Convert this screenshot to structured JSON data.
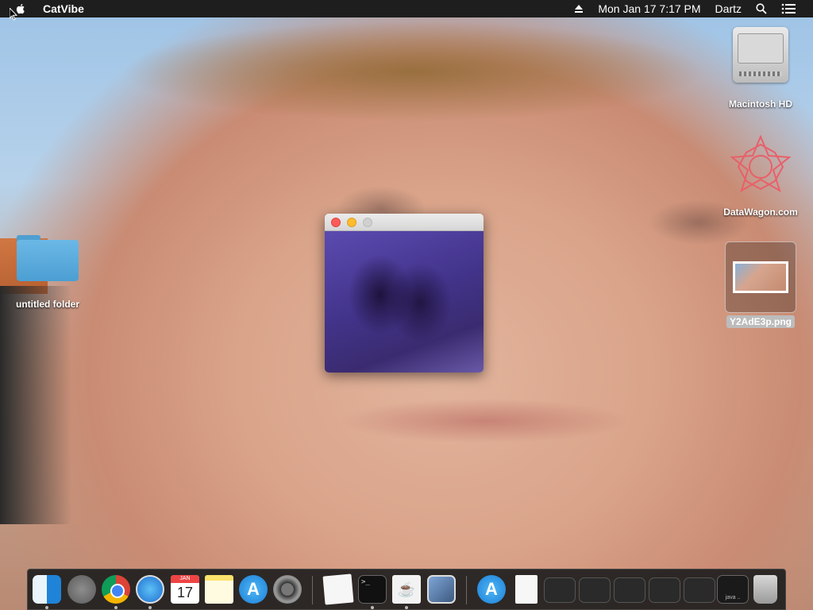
{
  "menubar": {
    "app_name": "CatVibe",
    "datetime": "Mon Jan 17  7:17 PM",
    "user": "Dartz",
    "icons": [
      "apple-icon",
      "eject-icon",
      "search-icon",
      "list-icon"
    ]
  },
  "desktop": {
    "icons": [
      {
        "label": "Macintosh HD",
        "icon": "hard-drive-icon"
      },
      {
        "label": "DataWagon.com",
        "icon": "datawagon-icon"
      },
      {
        "label": "Y2AdE3p.png",
        "icon": "image-file-icon"
      },
      {
        "label": "untitled folder",
        "icon": "folder-icon"
      }
    ]
  },
  "window": {
    "title": "",
    "content": "video-feed"
  },
  "dock": {
    "calendar_month": "JAN",
    "calendar_day": "17",
    "terminal_prompt": ">_",
    "thumb_java_label": "java ..",
    "items": [
      "Finder",
      "Launchpad",
      "Google Chrome",
      "Safari",
      "Calendar",
      "Notes",
      "App Store",
      "System Preferences",
      "TextEdit",
      "Terminal",
      "Java",
      "Preview",
      "App Store Downloads",
      "Document",
      "Window 1",
      "Window 2",
      "Window 3",
      "Window 4",
      "Window 5",
      "java",
      "Trash"
    ]
  }
}
